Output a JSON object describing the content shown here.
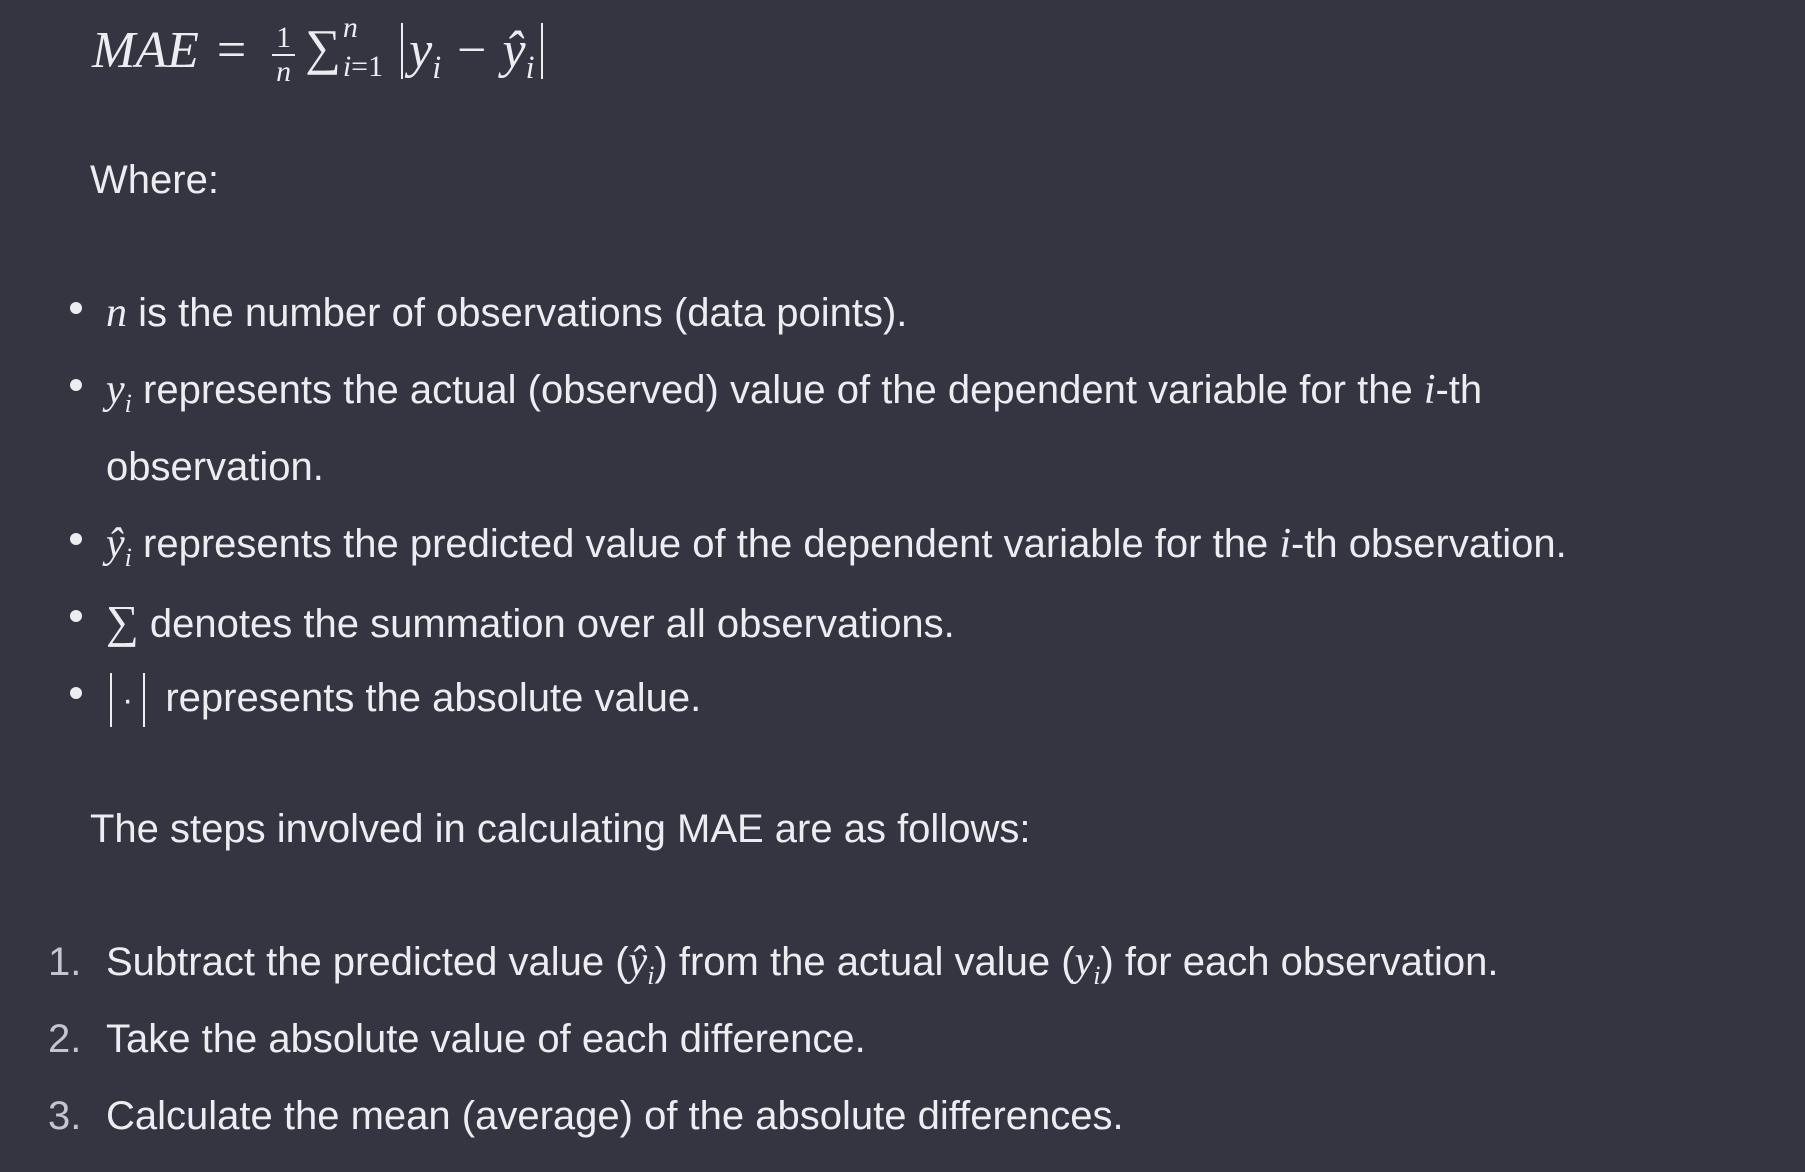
{
  "formula": {
    "lhs": "MAE",
    "equals": "=",
    "frac_num": "1",
    "frac_den": "n",
    "sigma": "∑",
    "sum_upper": "n",
    "sum_lower_var": "i",
    "sum_lower_rest": "=1",
    "y": "y",
    "sub_i": "i",
    "minus": "−",
    "yhat": "ŷ"
  },
  "where_label": "Where:",
  "bullets": [
    {
      "symbol": "n",
      "text": " is the number of observations (data points)."
    },
    {
      "symbol": "y",
      "symbol_sub": "i",
      "text": " represents the actual (observed) value of the dependent variable for the ",
      "inline_var": "i",
      "text_after": "-th",
      "continuation": "observation."
    },
    {
      "symbol": "ŷ",
      "symbol_sub": "i",
      "text": " represents the predicted value of the dependent variable for the ",
      "inline_var": "i",
      "text_after": "-th observation."
    },
    {
      "symbol": "∑",
      "text": " denotes the summation over all observations."
    },
    {
      "symbol_dot": "·",
      "text": "represents the absolute value."
    }
  ],
  "steps_intro": "The steps involved in calculating MAE are as follows:",
  "steps": [
    {
      "num": "1.",
      "pre": "Subtract the predicted value (",
      "v1": "ŷ",
      "v1_sub": "i",
      "mid": ") from the actual value (",
      "v2": "y",
      "v2_sub": "i",
      "post": ") for each observation."
    },
    {
      "num": "2.",
      "text": "Take the absolute value of each difference."
    },
    {
      "num": "3.",
      "text": "Calculate the mean (average) of the absolute differences."
    }
  ]
}
